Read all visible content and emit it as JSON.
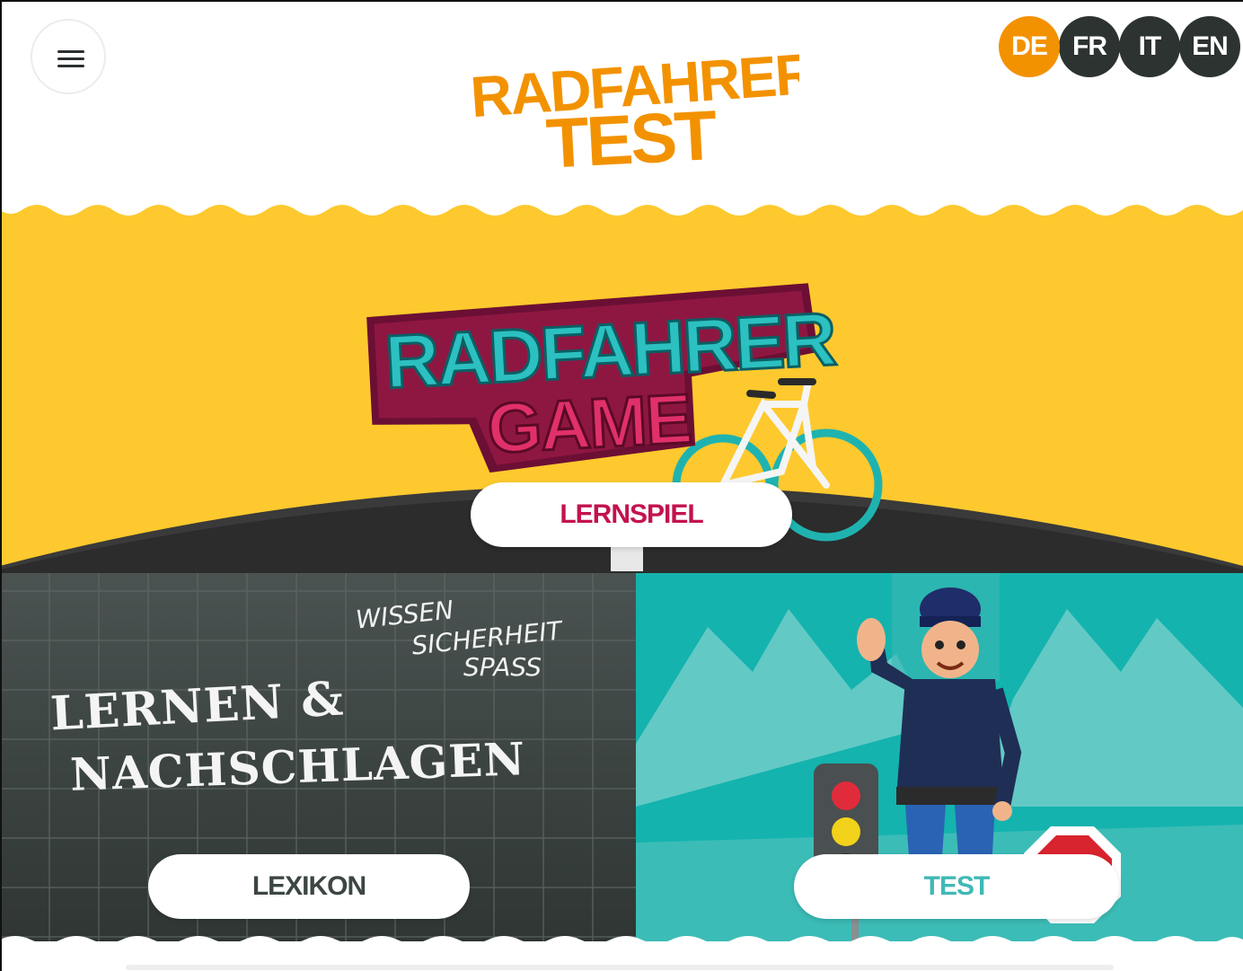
{
  "header": {
    "menu_icon": "hamburger-menu-icon",
    "logo_line1": "RADFAHRER",
    "logo_line2": "TEST",
    "languages": [
      {
        "code": "DE",
        "active": true
      },
      {
        "code": "FR",
        "active": false
      },
      {
        "code": "IT",
        "active": false
      },
      {
        "code": "EN",
        "active": false
      }
    ]
  },
  "game": {
    "logo_line1": "RADFAHRER",
    "logo_line2": "GAME",
    "button_label": "LERNSPIEL"
  },
  "learn": {
    "tagline": [
      "WISSEN",
      "SICHERHEIT",
      "SPASS"
    ],
    "title_line1": "LERNEN &",
    "title_line2": "NACHSCHLAGEN",
    "button_label": "LEXIKON"
  },
  "test": {
    "button_label": "TEST"
  },
  "colors": {
    "brand_orange": "#f39200",
    "game_yellow": "#fdc92e",
    "dark_panel": "#3f4744",
    "teal_panel": "#14b3ae",
    "lernspiel_text": "#c3124f",
    "test_text": "#3fb9b6",
    "lang_dark": "#2c3331"
  }
}
